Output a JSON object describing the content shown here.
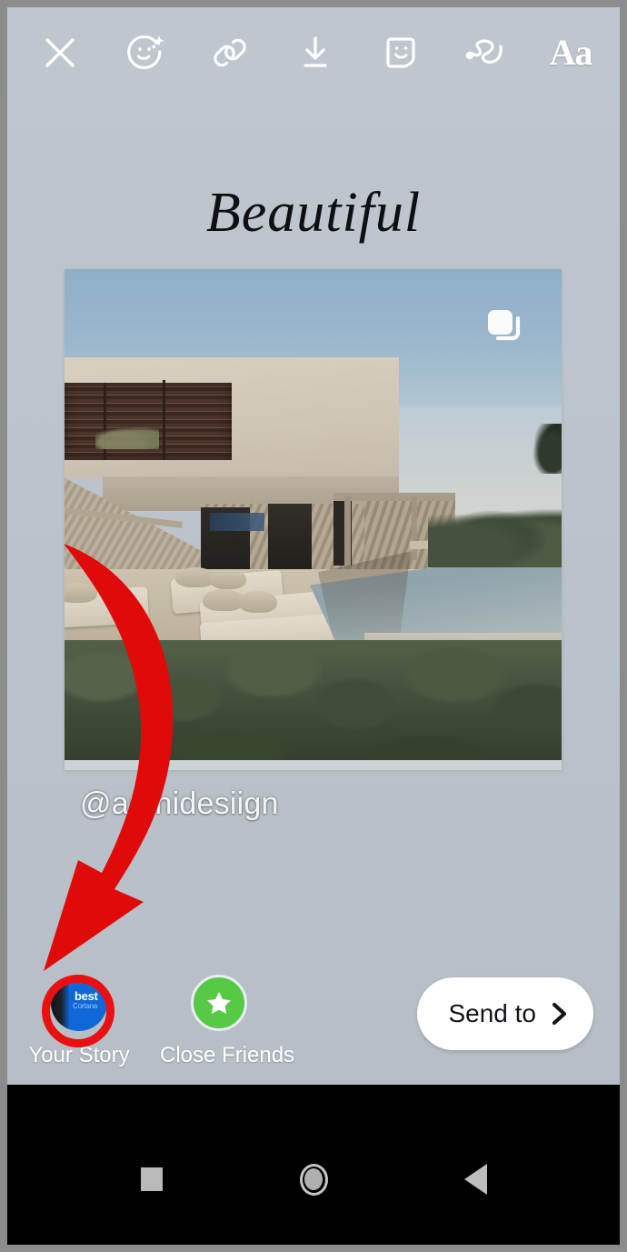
{
  "app": {
    "name": "Instagram Story Editor",
    "platform": "Android"
  },
  "toolbar": {
    "items": [
      {
        "name": "close-icon",
        "label": "Close"
      },
      {
        "name": "effects-icon",
        "label": "Effects"
      },
      {
        "name": "link-icon",
        "label": "Link"
      },
      {
        "name": "download-icon",
        "label": "Save"
      },
      {
        "name": "sticker-icon",
        "label": "Stickers"
      },
      {
        "name": "draw-icon",
        "label": "Draw"
      },
      {
        "name": "text-icon",
        "label": "Aa"
      }
    ],
    "text_tool_label": "Aa"
  },
  "canvas": {
    "caption": "Beautiful",
    "username_sticker": "@archidesiign",
    "carousel_badge": "carousel-icon",
    "background_color": "#bcc3cb"
  },
  "annotations": {
    "arrow_color": "#e00a0a",
    "ring_color": "#e81010",
    "arrow_name": "red-arrow-annotation",
    "ring_name": "red-circle-annotation"
  },
  "sharebar": {
    "destinations": [
      {
        "label": "Your Story",
        "avatar_badge_text": "best",
        "avatar_badge_subtext": "Cortana",
        "avatar_color": "#1068d8",
        "highlighted": true
      },
      {
        "label": "Close Friends",
        "icon": "star-icon",
        "icon_color": "#56c945",
        "highlighted": false
      }
    ],
    "send_button": {
      "label": "Send to",
      "icon": "chevron-right-icon"
    }
  },
  "navbar": {
    "buttons": [
      {
        "name": "recents-button",
        "label": "Recents"
      },
      {
        "name": "home-button",
        "label": "Home"
      },
      {
        "name": "back-button",
        "label": "Back"
      }
    ]
  }
}
